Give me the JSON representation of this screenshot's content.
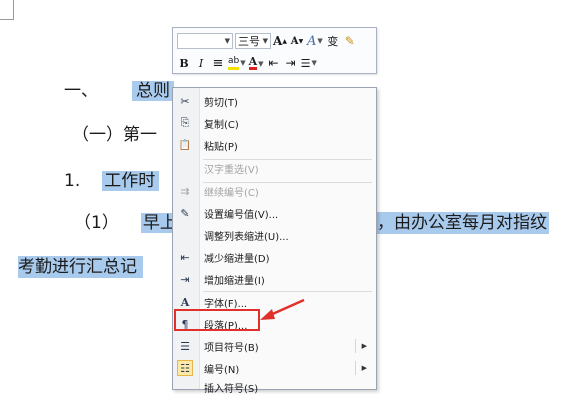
{
  "document": {
    "line1_number": "一、",
    "line1_text": "总则",
    "line2_text": "（一）第一",
    "line3_number": "1.",
    "line3_text": "工作时",
    "line4_number": "（1）",
    "line4_text_left": "早上",
    "line4_text_right": "，由办公室每月对指纹",
    "line5_text": "考勤进行汇总记"
  },
  "toolbar": {
    "font_name_value": "",
    "font_size_value": "三号",
    "grow_font": "A",
    "shrink_font": "A",
    "font_style": "A",
    "phonetic": "变",
    "format_painter": "✎",
    "bold": "B",
    "italic": "I",
    "center": "≡",
    "highlight": "ab",
    "font_color": "A",
    "decrease_indent": "⇤",
    "increase_indent": "⇥",
    "bullets": "☰"
  },
  "menu": {
    "items": [
      {
        "label": "剪切(T)",
        "icon": "scissors-icon",
        "glyph": "✂"
      },
      {
        "label": "复制(C)",
        "icon": "copy-icon",
        "glyph": "⎘"
      },
      {
        "label": "粘贴(P)",
        "icon": "paste-icon",
        "glyph": "📋"
      },
      {
        "label": "汉字重选(V)",
        "icon": "",
        "glyph": ""
      },
      {
        "label": "继续编号(C)",
        "icon": "continue-numbering-icon",
        "glyph": "⇉"
      },
      {
        "label": "设置编号值(V)...",
        "icon": "set-numbering-icon",
        "glyph": "✎"
      },
      {
        "label": "调整列表缩进(U)...",
        "icon": "",
        "glyph": ""
      },
      {
        "label": "减少缩进量(D)",
        "icon": "decrease-indent-icon",
        "glyph": "⇤"
      },
      {
        "label": "增加缩进量(I)",
        "icon": "increase-indent-icon",
        "glyph": "⇥"
      },
      {
        "label": "字体(F)...",
        "icon": "font-icon",
        "glyph": "A"
      },
      {
        "label": "段落(P)...",
        "icon": "paragraph-icon",
        "glyph": "¶"
      },
      {
        "label": "项目符号(B)",
        "icon": "bullets-icon",
        "glyph": "☰"
      },
      {
        "label": "编号(N)",
        "icon": "numbering-icon",
        "glyph": "☷"
      },
      {
        "label": "插入符号(S)",
        "icon": "",
        "glyph": ""
      }
    ],
    "submenu_arrow": "▶"
  },
  "colors": {
    "selection": "#a8caec",
    "highlight_box": "#e0302a",
    "font_color_bar": "#e02020",
    "highlighter_bar": "#f5e000"
  }
}
